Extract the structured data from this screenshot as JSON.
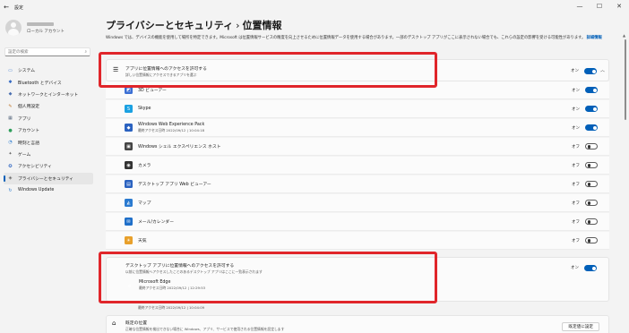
{
  "window": {
    "back": "←",
    "title": "設定",
    "controls": [
      "—",
      "☐",
      "✕"
    ]
  },
  "user": {
    "account": "ローカル アカウント"
  },
  "search": {
    "placeholder": "設定の検索",
    "icon": "⌕"
  },
  "nav": [
    {
      "label": "システム",
      "icon": "▭",
      "color": "#3a78d0"
    },
    {
      "label": "Bluetooth とデバイス",
      "icon": "✱",
      "color": "#2a62c0"
    },
    {
      "label": "ネットワークとインターネット",
      "icon": "◆",
      "color": "#4a6fb0"
    },
    {
      "label": "個人用設定",
      "icon": "✎",
      "color": "#c0772b"
    },
    {
      "label": "アプリ",
      "icon": "▦",
      "color": "#5a6a80"
    },
    {
      "label": "アカウント",
      "icon": "●",
      "color": "#2e9e5b"
    },
    {
      "label": "時刻と言語",
      "icon": "◔",
      "color": "#2a7ad0"
    },
    {
      "label": "ゲーム",
      "icon": "✦",
      "color": "#666"
    },
    {
      "label": "アクセシビリティ",
      "icon": "✪",
      "color": "#2a62c0"
    },
    {
      "label": "プライバシーとセキュリティ",
      "icon": "◈",
      "color": "#666",
      "active": true
    },
    {
      "label": "Windows Update",
      "icon": "↻",
      "color": "#2a7ad0"
    }
  ],
  "header": {
    "parent": "プライバシーとセキュリティ",
    "separator": "›",
    "current": "位置情報"
  },
  "description": {
    "text": "Windows では、デバイスの機能を使用して場所を特定できます。Microsoft は位置情報サービスの精度を向上させるために位置情報データを使用する場合があります。一部のデスクトップ アプリがここに表示されない場合でも、これらの設定の影響を受ける可能性があります。",
    "link": "詳細情報"
  },
  "app_access": {
    "title": "アプリに位置情報へのアクセスを許可する",
    "subtitle": "詳しい位置情報にアクセスできるアプリを選ぶ",
    "state": "オン",
    "chevron": "︿"
  },
  "apps": [
    {
      "name": "3D ビューアー",
      "sub": "",
      "state": "オン",
      "on": true,
      "icon": "◩",
      "color": "#3b6fd4"
    },
    {
      "name": "Skype",
      "sub": "",
      "state": "オン",
      "on": true,
      "icon": "S",
      "color": "#1ba1e2"
    },
    {
      "name": "Windows Web Experience Pack",
      "sub": "最終アクセス日時 2022/09/12 | 10:04:18",
      "state": "オン",
      "on": true,
      "icon": "◆",
      "color": "#2a62c0"
    },
    {
      "name": "Windows シェル エクスペリエンス ホスト",
      "sub": "",
      "state": "オフ",
      "on": false,
      "icon": "▣",
      "color": "#444"
    },
    {
      "name": "カメラ",
      "sub": "",
      "state": "オフ",
      "on": false,
      "icon": "◉",
      "color": "#333"
    },
    {
      "name": "デスクトップ アプリ Web ビューアー",
      "sub": "",
      "state": "オフ",
      "on": false,
      "icon": "▤",
      "color": "#2a62c0"
    },
    {
      "name": "マップ",
      "sub": "",
      "state": "オフ",
      "on": false,
      "icon": "◭",
      "color": "#2a7ad0"
    },
    {
      "name": "メール/カレンダー",
      "sub": "",
      "state": "オフ",
      "on": false,
      "icon": "✉",
      "color": "#1f6fc9"
    },
    {
      "name": "天気",
      "sub": "",
      "state": "オフ",
      "on": false,
      "icon": "☀",
      "color": "#e8a02b"
    }
  ],
  "desktop_access": {
    "title": "デスクトップ アプリに位置情報へのアクセスを許可する",
    "subtitle": "以前に位置情報へアクセスしたことのあるデスクトップ アプリはここに一覧表示されます",
    "state": "オン"
  },
  "edge": {
    "name": "Microsoft Edge",
    "sub": "最終アクセス日時 2022/09/12 | 12:29:53",
    "icon": "e",
    "color": "#0c88c8"
  },
  "partial_row": {
    "sub": "最終アクセス日時 2022/09/12 | 10:04:09"
  },
  "default_location": {
    "title": "既定の位置",
    "subtitle": "正確な位置情報を検出できない場合に Windows、アプリ、サービスで使用される位置情報を設定します",
    "button": "既定値に設定",
    "icon": "⌂"
  },
  "scroll": {
    "up_icon": "▲"
  },
  "accent": "#005fb8",
  "highlight_color": "#e0252a"
}
